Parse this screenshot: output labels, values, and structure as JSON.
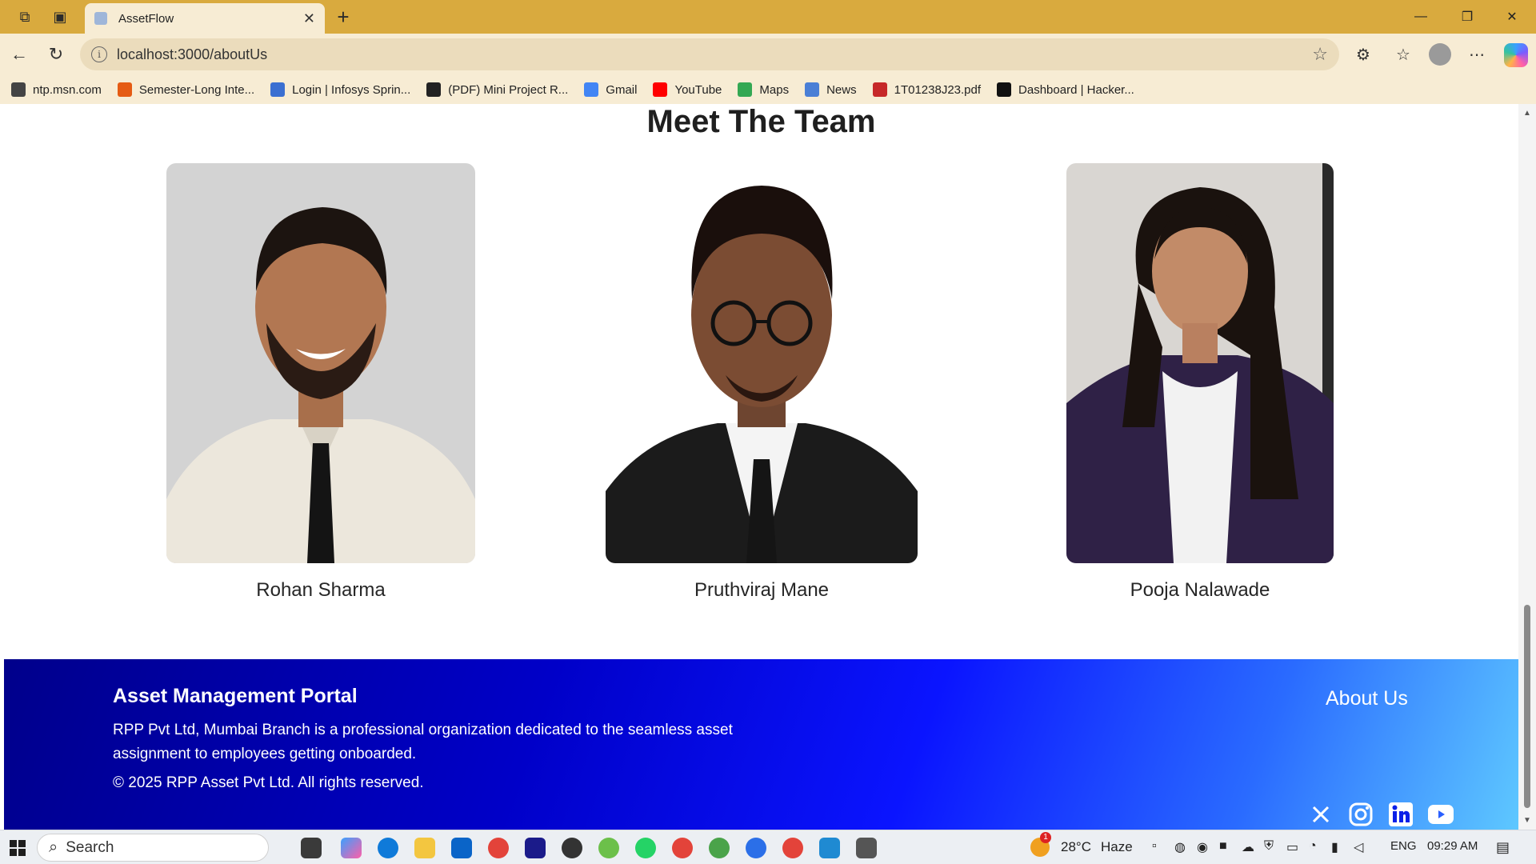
{
  "browser": {
    "tab_title": "AssetFlow",
    "url": "localhost:3000/aboutUs"
  },
  "bookmarks": [
    {
      "label": "ntp.msn.com",
      "icon": "globe-icon",
      "color": "#444444"
    },
    {
      "label": "Semester-Long Inte...",
      "icon": "bar-icon",
      "color": "#e55b13"
    },
    {
      "label": "Login | Infosys Sprin...",
      "icon": "infosys-icon",
      "color": "#3b6fd1"
    },
    {
      "label": "(PDF) Mini Project R...",
      "icon": "academia-icon",
      "color": "#222222"
    },
    {
      "label": "Gmail",
      "icon": "google-icon",
      "color": "#4285f4"
    },
    {
      "label": "YouTube",
      "icon": "youtube-icon",
      "color": "#ff0000"
    },
    {
      "label": "Maps",
      "icon": "maps-icon",
      "color": "#34a853"
    },
    {
      "label": "News",
      "icon": "news-icon",
      "color": "#4a7fd6"
    },
    {
      "label": "1T01238J23.pdf",
      "icon": "pdf-icon",
      "color": "#c62828"
    },
    {
      "label": "Dashboard | Hacker...",
      "icon": "hackerrank-icon",
      "color": "#111111"
    }
  ],
  "team": {
    "title": "Meet The Team",
    "members": [
      {
        "name": "Rohan Sharma"
      },
      {
        "name": "Pruthviraj Mane"
      },
      {
        "name": "Pooja Nalawade"
      }
    ]
  },
  "footer": {
    "heading": "Asset Management Portal",
    "description": "RPP Pvt Ltd, Mumbai Branch is a professional organization dedicated to the seamless asset assignment to employees getting onboarded.",
    "copyright": "© 2025 RPP Asset Pvt Ltd. All rights reserved.",
    "about_link": "About Us",
    "social": [
      "x-icon",
      "instagram-icon",
      "linkedin-icon",
      "youtube-icon"
    ]
  },
  "taskbar": {
    "search_placeholder": "Search",
    "weather_temp": "28°C",
    "weather_desc": "Haze",
    "language": "ENG",
    "time": "09:29 AM",
    "weather_badge": "1"
  }
}
